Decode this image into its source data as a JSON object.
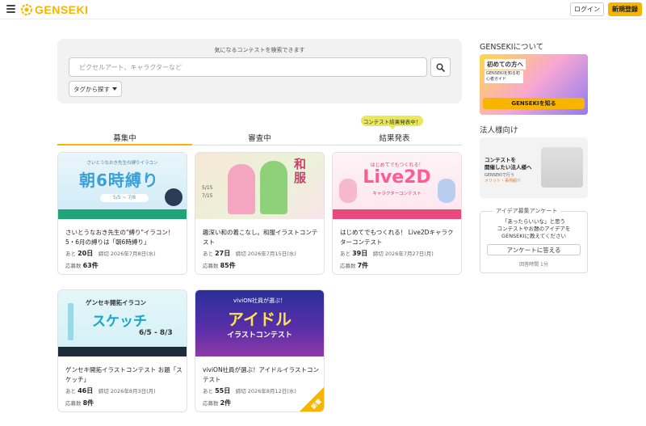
{
  "header": {
    "logo_text": "GENSEKI",
    "login_label": "ログイン",
    "register_label": "新規登録",
    "brand_color": "#f7b500"
  },
  "search": {
    "caption": "気になるコンテストを検索できます",
    "placeholder": "ピクセルアート、キャラクターなど",
    "tag_button_label": "タグから探す"
  },
  "tabs": [
    {
      "label": "募集中",
      "active": true
    },
    {
      "label": "審査中",
      "active": false
    },
    {
      "label": "結果発表",
      "active": false
    }
  ],
  "tab_badge": "コンテスト結果発表中！",
  "cards": [
    {
      "image": {
        "top_text": "さいとうなおき先生の縛りイラコン",
        "main_text": "朝6時縛り",
        "dates": "5/5 ~ 7/8"
      },
      "title": "さいとうなおき先生の\"縛り\"イラコン！ 5・6月の縛りは「朝6時縛り」",
      "days_prefix": "あと",
      "days": "20日",
      "deadline": "締切 2026年7月8日(水)",
      "entries_label": "応募数",
      "entries": "63件"
    },
    {
      "image": {
        "main_text": "和服",
        "dates_top": "5/15",
        "dates_bottom": "7/15"
      },
      "title": "趣深い和の着こなし。和服イラストコンテスト",
      "days_prefix": "あと",
      "days": "27日",
      "deadline": "締切 2026年7月15日(水)",
      "entries_label": "応募数",
      "entries": "85件"
    },
    {
      "image": {
        "top_text": "はじめてでもつくれる！",
        "main_text": "Live2D",
        "sub_text": "キャラクターコンテスト"
      },
      "title": "はじめてでもつくれる！ Live2Dキャラクターコンテスト",
      "days_prefix": "あと",
      "days": "39日",
      "deadline": "締切 2026年7月27日(月)",
      "entries_label": "応募数",
      "entries": "7件"
    },
    {
      "image": {
        "top_text": "ゲンセキ開拓イラコン",
        "main_text": "スケッチ",
        "dates": "6/5 - 8/3"
      },
      "title": "ゲンセキ開拓イラストコンテスト お題「スケッチ」",
      "days_prefix": "あと",
      "days": "46日",
      "deadline": "締切 2026年8月3日(月)",
      "entries_label": "応募数",
      "entries": "8件"
    },
    {
      "image": {
        "top_text": "viviON社員が選ぶ！",
        "main_text": "アイドル",
        "sub_text": "イラストコンテスト"
      },
      "title": "viviON社員が選ぶ！アイドルイラストコンテスト",
      "days_prefix": "あと",
      "days": "55日",
      "deadline": "締切 2026年8月12日(水)",
      "entries_label": "応募数",
      "entries": "2件",
      "new_badge": "新着"
    }
  ],
  "sidebar": {
    "about_heading": "GENSEKIについて",
    "about_banner": {
      "top": "初めての方へ",
      "sub": "GENSEKIを知る初心者ガイド",
      "button": "GENSEKIを知る"
    },
    "corp_heading": "法人様向け",
    "corp_banner": {
      "line1": "コンテストを",
      "line2": "開催したい法人様へ",
      "line3": "GENSEKIで行う",
      "line4": "メリット・事例紹介"
    },
    "survey": {
      "title": "アイデア募集アンケート",
      "line1": "「あったらいいな」と思う",
      "line2": "コンテストやお題のアイデアを",
      "line3": "GENSEKIに教えてください",
      "button": "アンケートに答える",
      "time": "回答時間 1分"
    }
  }
}
